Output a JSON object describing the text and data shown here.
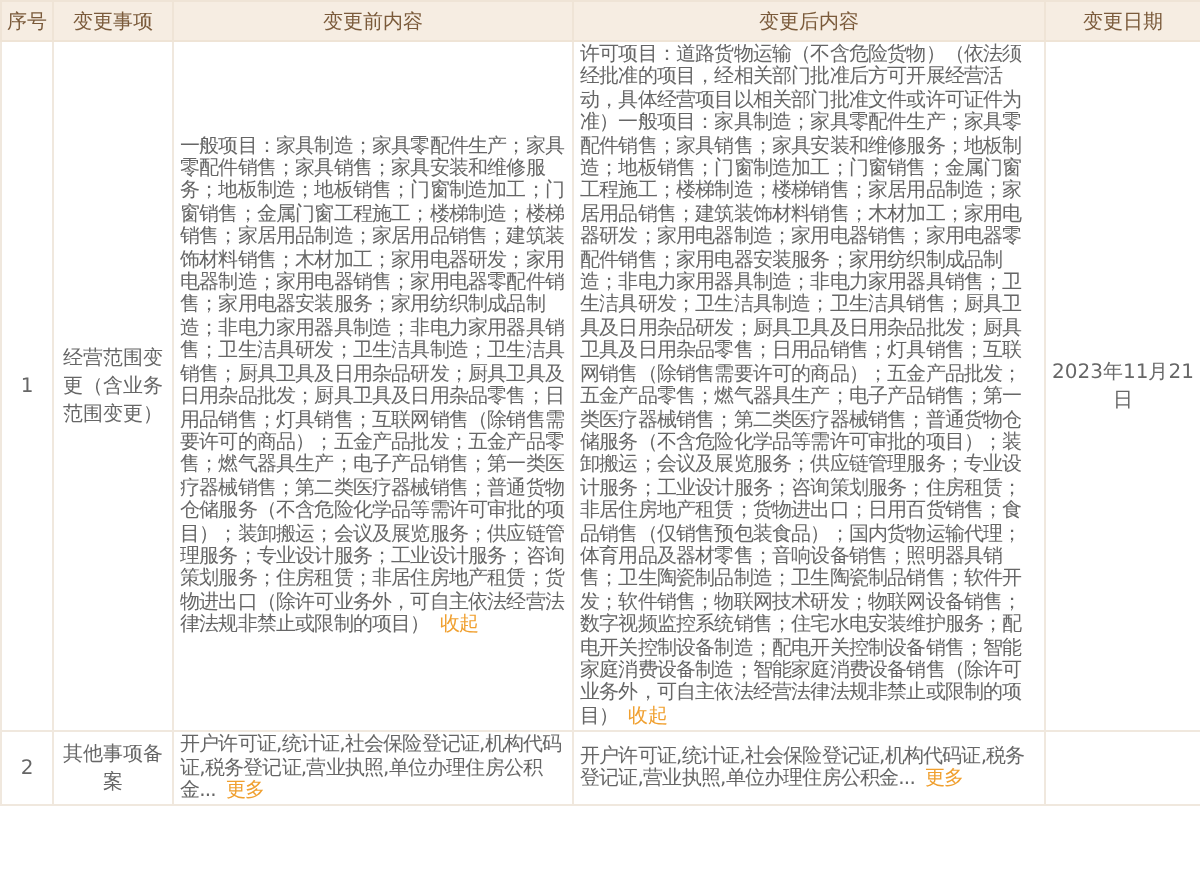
{
  "table": {
    "columns": [
      "序号",
      "变更事项",
      "变更前内容",
      "变更后内容",
      "变更日期"
    ],
    "rows": [
      {
        "index": "1",
        "item": "经营范围变更（含业务范围变更）",
        "before": {
          "text": "一般项目：家具制造；家具零配件生产；家具零配件销售；家具销售；家具安装和维修服务；地板制造；地板销售；门窗制造加工；门窗销售；金属门窗工程施工；楼梯制造；楼梯销售；家居用品制造；家居用品销售；建筑装饰材料销售；木材加工；家用电器研发；家用电器制造；家用电器销售；家用电器零配件销售；家用电器安装服务；家用纺织制成品制造；非电力家用器具制造；非电力家用器具销售；卫生洁具研发；卫生洁具制造；卫生洁具销售；厨具卫具及日用杂品研发；厨具卫具及日用杂品批发；厨具卫具及日用杂品零售；日用品销售；灯具销售；互联网销售（除销售需要许可的商品）；五金产品批发；五金产品零售；燃气器具生产；电子产品销售；第一类医疗器械销售；第二类医疗器械销售；普通货物仓储服务（不含危险化学品等需许可审批的项目）；装卸搬运；会议及展览服务；供应链管理服务；专业设计服务；工业设计服务；咨询策划服务；住房租赁；非居住房地产租赁；货物进出口（除许可业务外，可自主依法经营法律法规非禁止或限制的项目）",
          "link": "收起"
        },
        "after": {
          "text": "许可项目：道路货物运输（不含危险货物）（依法须经批准的项目，经相关部门批准后方可开展经营活动，具体经营项目以相关部门批准文件或许可证件为准）一般项目：家具制造；家具零配件生产；家具零配件销售；家具销售；家具安装和维修服务；地板制造；地板销售；门窗制造加工；门窗销售；金属门窗工程施工；楼梯制造；楼梯销售；家居用品制造；家居用品销售；建筑装饰材料销售；木材加工；家用电器研发；家用电器制造；家用电器销售；家用电器零配件销售；家用电器安装服务；家用纺织制成品制造；非电力家用器具制造；非电力家用器具销售；卫生洁具研发；卫生洁具制造；卫生洁具销售；厨具卫具及日用杂品研发；厨具卫具及日用杂品批发；厨具卫具及日用杂品零售；日用品销售；灯具销售；互联网销售（除销售需要许可的商品）；五金产品批发；五金产品零售；燃气器具生产；电子产品销售；第一类医疗器械销售；第二类医疗器械销售；普通货物仓储服务（不含危险化学品等需许可审批的项目）；装卸搬运；会议及展览服务；供应链管理服务；专业设计服务；工业设计服务；咨询策划服务；住房租赁；非居住房地产租赁；货物进出口；日用百货销售；食品销售（仅销售预包装食品）；国内货物运输代理；体育用品及器材零售；音响设备销售；照明器具销售；卫生陶瓷制品制造；卫生陶瓷制品销售；软件开发；软件销售；物联网技术研发；物联网设备销售；数字视频监控系统销售；住宅水电安装维护服务；配电开关控制设备制造；配电开关控制设备销售；智能家庭消费设备制造；智能家庭消费设备销售（除许可业务外，可自主依法经营法律法规非禁止或限制的项目）",
          "link": "收起"
        },
        "date": "2023年11月21日"
      },
      {
        "index": "2",
        "item": "其他事项备案",
        "before": {
          "text": "开户许可证,统计证,社会保险登记证,机构代码证,税务登记证,营业执照,单位办理住房公积金...",
          "link": "更多"
        },
        "after": {
          "text": "开户许可证,统计证,社会保险登记证,机构代码证,税务登记证,营业执照,单位办理住房公积金...",
          "link": "更多"
        }
      }
    ]
  }
}
